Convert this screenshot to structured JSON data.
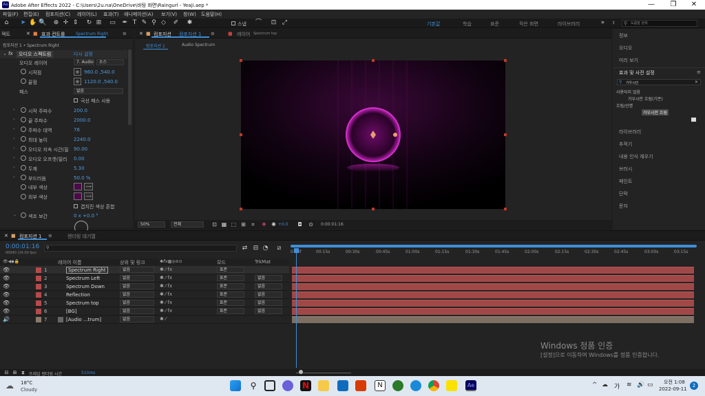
{
  "window": {
    "title": "Adobe After Effects 2022 - C:\\Users\\2u.na\\OneDrive\\바탕 화면\\Raingurl - Yeaji.aep *",
    "logo": "Ae"
  },
  "menu": [
    "파일(F)",
    "편집(E)",
    "컴포지션(C)",
    "레이어(L)",
    "효과(T)",
    "애니메이션(A)",
    "보기(V)",
    "창(W)",
    "도움말(H)"
  ],
  "toolbar": {
    "snap_label": "스냅",
    "workspaces": [
      "기본값",
      "학습",
      "표준",
      "작은 화면",
      "라이브러리"
    ],
    "search_placeholder": "도움말 검색"
  },
  "effect_controls": {
    "tab_project": "젝트",
    "tab_effects": "효과 컨트롤",
    "tab_effects_target": "Spectrum Right",
    "breadcrumb": "컴포지션 1 • Spectrum Right",
    "effect_name": "오디오 스펙트럼",
    "reset": "다시 설정",
    "params": [
      {
        "label": "오디오 레이어",
        "value": "7. Audio",
        "extra": "소스"
      },
      {
        "label": "시작점",
        "value": "960.0 ,540.0"
      },
      {
        "label": "끝점",
        "value": "1120.0 ,540.0"
      },
      {
        "label": "패스",
        "value": "없음"
      },
      {
        "label": "극선 패스 사용",
        "value": ""
      },
      {
        "label": "시작 주파수",
        "value": "200.0"
      },
      {
        "label": "끝 주파수",
        "value": "2000.0"
      },
      {
        "label": "주파수 대역",
        "value": "76"
      },
      {
        "label": "최대 높이",
        "value": "2240.0"
      },
      {
        "label": "오디오 지속 시간(밀",
        "value": "90.00"
      },
      {
        "label": "오디오 오프셋(밀리",
        "value": "0.00"
      },
      {
        "label": "두께",
        "value": "5.30"
      },
      {
        "label": "부드러움",
        "value": "50.0 %"
      },
      {
        "label": "내부 색상",
        "value": ""
      },
      {
        "label": "외부 색상",
        "value": ""
      },
      {
        "label": "겹치진 색상 혼합",
        "value": ""
      },
      {
        "label": "색조 보간",
        "value": "0 x +0.0 °"
      }
    ]
  },
  "viewer": {
    "tab_label": "컴포지션",
    "tab_comp": "컴포지션 1",
    "tab_layer": "레이어",
    "tab_layer_name": "Spectrum top",
    "crumb_1": "컴포지션 1",
    "crumb_2": "Audio Spectrum",
    "zoom": "50%",
    "resolution": "전체",
    "exposure": "+0.0",
    "timecode": "0:00:01:16"
  },
  "right_panel": {
    "items_top": [
      "정보",
      "오디오",
      "미리 보기"
    ],
    "effects_title": "효과 및 사전 설정",
    "effects_search": "가우시안",
    "tree": [
      {
        "label": "사용되지 않음",
        "level": 0
      },
      {
        "label": "가우시안 흐림(기존)",
        "level": 1
      },
      {
        "label": "흐림/선명",
        "level": 0
      },
      {
        "label": "가우시안 흐림",
        "level": 1
      }
    ],
    "items_bottom": [
      "라이브러리",
      "추적기",
      "내용 인식 채우기",
      "브러시",
      "페인트",
      "단락",
      "문자"
    ]
  },
  "timeline": {
    "tab_comp": "컴포지션 1",
    "tab_render": "렌더링 대기열",
    "timecode": "0:00:01:16",
    "frame_info": "00040 (24.00 fps)",
    "headers": {
      "source": "레이어 이름",
      "parent": "상위 및 링크",
      "mode": "모드",
      "trkmat": "TrkMat"
    },
    "ruler": [
      "0:00f",
      "00:15s",
      "00:30s",
      "00:45s",
      "01:00s",
      "01:15s",
      "01:30s",
      "01:45s",
      "02:00s",
      "02:15s",
      "02:30s",
      "02:45s",
      "03:00s",
      "03:15s"
    ],
    "layers": [
      {
        "num": "1",
        "name": "Spectrum Right",
        "parent": "없음",
        "mode": "표준",
        "trk": ""
      },
      {
        "num": "2",
        "name": "Spectrum Left",
        "parent": "없음",
        "mode": "표준",
        "trk": "없음"
      },
      {
        "num": "3",
        "name": "Spectrum Down",
        "parent": "없음",
        "mode": "표준",
        "trk": "없음"
      },
      {
        "num": "4",
        "name": "Reflection",
        "parent": "없음",
        "mode": "표준",
        "trk": "없음"
      },
      {
        "num": "5",
        "name": "Spectrum top",
        "parent": "없음",
        "mode": "표준",
        "trk": "없음"
      },
      {
        "num": "6",
        "name": "[BG]",
        "parent": "없음",
        "mode": "표준",
        "trk": "없음"
      },
      {
        "num": "7",
        "name": "[Audio ...trum]",
        "parent": "없음",
        "mode": "",
        "trk": ""
      }
    ],
    "render_time_label": "프레임 렌더링 시간",
    "render_time": "510ms"
  },
  "watermark": {
    "title": "Windows 정품 인증",
    "subtitle": "[설정]으로 이동하여 Windows를 정품 인증합니다."
  },
  "taskbar": {
    "temp": "18°C",
    "weather": "Cloudy",
    "lang": "가",
    "time": "오전 1:08",
    "date": "2022-09-11",
    "notif": "2"
  },
  "colors": {
    "accent": "#3f8fd9",
    "layer_label": "#b64a4a",
    "layer_bar": "#a04848",
    "spectrum": "#c020b8"
  }
}
